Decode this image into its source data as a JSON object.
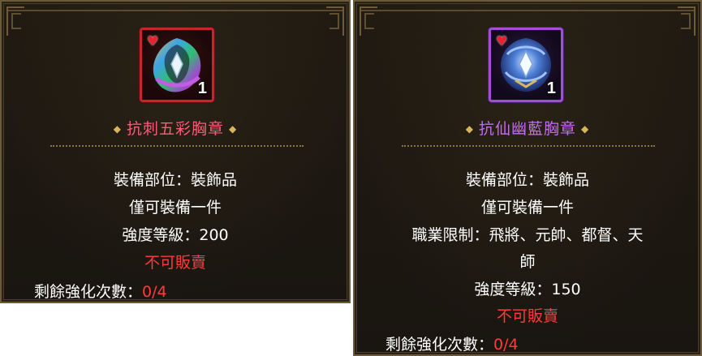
{
  "panels": [
    {
      "name": "抗刺五彩胸章",
      "quantity": "1",
      "slot": "裝備部位：裝飾品",
      "limit": "僅可裝備一件",
      "strength": "強度等級：200",
      "tradable": "不可販賣",
      "enhance_label": "剩餘強化次數：",
      "enhance_value": "0/4",
      "frame_color": "#c7242b"
    },
    {
      "name": "抗仙幽藍胸章",
      "quantity": "1",
      "slot": "裝備部位：裝飾品",
      "limit": "僅可裝備一件",
      "class_line1": "職業限制：飛將、元帥、都督、天",
      "class_line2": "師",
      "strength": "強度等級：150",
      "tradable": "不可販賣",
      "enhance_label": "剩餘強化次數：",
      "enhance_value": "0/4",
      "frame_color": "#a24fd6"
    }
  ],
  "icons": [
    "heart-icon",
    "diamond-icon",
    "badge-icon"
  ]
}
